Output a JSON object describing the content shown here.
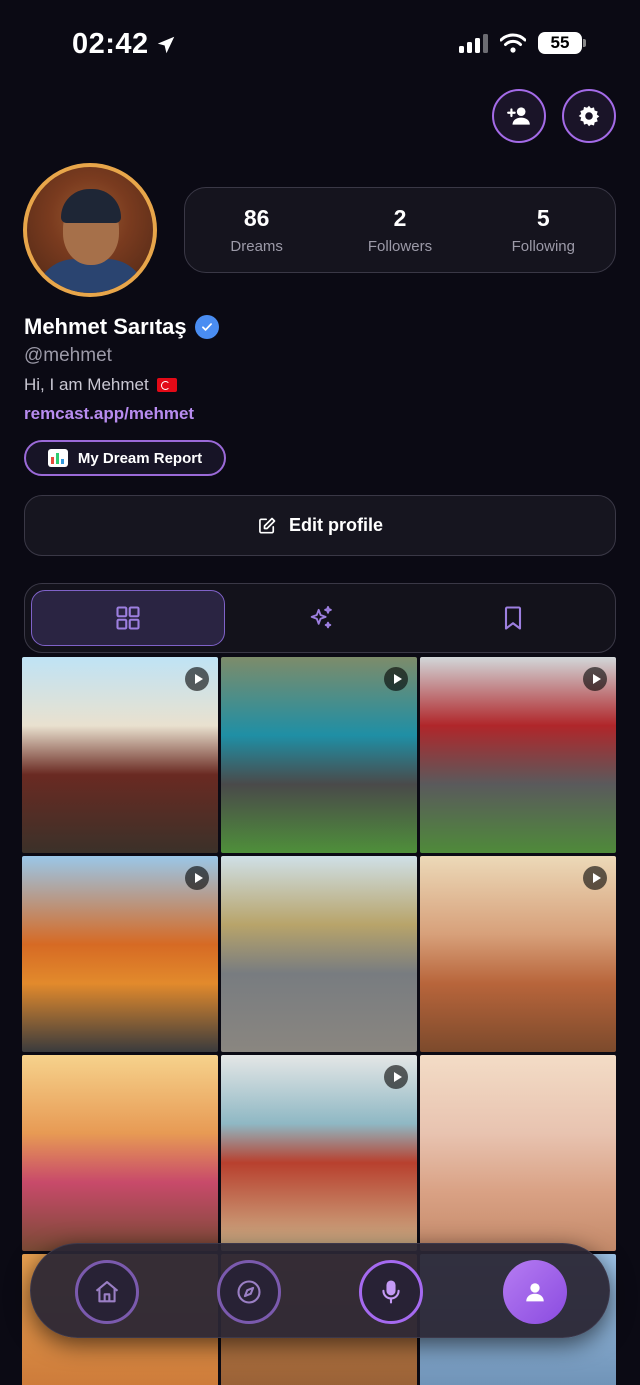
{
  "status_bar": {
    "time": "02:42",
    "battery": "55"
  },
  "profile": {
    "name": "Mehmet Sarıtaş",
    "handle": "@mehmet",
    "bio": "Hi, I am Mehmet",
    "link": "remcast.app/mehmet"
  },
  "stats": [
    {
      "value": "86",
      "label": "Dreams"
    },
    {
      "value": "2",
      "label": "Followers"
    },
    {
      "value": "5",
      "label": "Following"
    }
  ],
  "buttons": {
    "report": "My Dream Report",
    "edit": "Edit profile"
  },
  "tabs": [
    "grid-icon",
    "sparkles-icon",
    "bookmark-icon"
  ],
  "active_tab": 0,
  "grid_tiles": [
    {
      "scene": "three men posing with a red vintage car",
      "video": true
    },
    {
      "scene": "men repairing a teal vintage car",
      "video": true
    },
    {
      "scene": "man beside a red vintage car",
      "video": true
    },
    {
      "scene": "family with an orange vintage car",
      "video": true
    },
    {
      "scene": "cat running on street with ambulance",
      "video": false
    },
    {
      "scene": "couple at a laptop in a living room",
      "video": true
    },
    {
      "scene": "mother and daughters at sunset",
      "video": false
    },
    {
      "scene": "family fishing on a beach",
      "video": true
    },
    {
      "scene": "fish and seagulls in the sky",
      "video": false
    }
  ],
  "nav": [
    "home-icon",
    "compass-icon",
    "mic-icon",
    "profile-icon"
  ],
  "colors": {
    "accent": "#a46be8",
    "gold_ring": "#e8a64a",
    "verified": "#4a8df2",
    "link": "#b88cf0"
  }
}
